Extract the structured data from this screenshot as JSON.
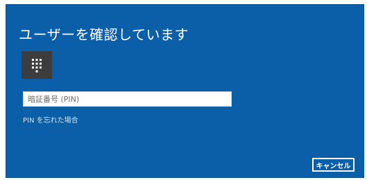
{
  "dialog": {
    "title": "ユーザーを確認しています",
    "credential_icon": "keypad-icon",
    "pin_input": {
      "placeholder": "暗証番号 (PIN)",
      "value": ""
    },
    "forgot_pin_label": "PIN を忘れた場合",
    "cancel_label": "キャンセル"
  },
  "colors": {
    "dialog_background": "#0b5ea8",
    "tile_background": "#3d3d3d",
    "text": "#ffffff",
    "link": "#cfe2f5"
  }
}
